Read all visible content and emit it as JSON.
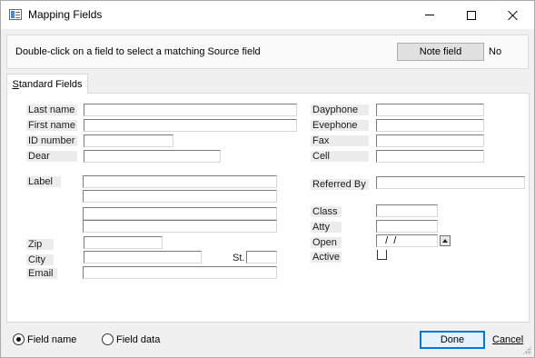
{
  "window": {
    "title": "Mapping Fields",
    "controls": {
      "minimize": "minimize-icon",
      "maximize": "maximize-icon",
      "close": "close-icon"
    }
  },
  "header": {
    "instruction": "Double-click on a field to select a matching Source field",
    "note_button_label": "Note field",
    "note_value": "No"
  },
  "tabs": [
    {
      "label": "Standard Fields",
      "underlined_char": "S",
      "rest": "tandard Fields"
    }
  ],
  "fields_left": {
    "last_name": {
      "label": "Last name",
      "value": ""
    },
    "first_name": {
      "label": "First name",
      "value": ""
    },
    "id_number": {
      "label": "ID number",
      "value": ""
    },
    "dear": {
      "label": "Dear",
      "value": ""
    },
    "label": {
      "label": "Label",
      "lines": [
        "",
        "",
        "",
        ""
      ]
    },
    "zip": {
      "label": "Zip",
      "value": ""
    },
    "city": {
      "label": "City",
      "value": ""
    },
    "state": {
      "label": "St.",
      "value": ""
    },
    "email": {
      "label": "Email",
      "value": ""
    }
  },
  "fields_right": {
    "dayphone": {
      "label": "Dayphone",
      "value": ""
    },
    "evephone": {
      "label": "Evephone",
      "value": ""
    },
    "fax": {
      "label": "Fax",
      "value": ""
    },
    "cell": {
      "label": "Cell",
      "value": ""
    },
    "referred_by": {
      "label": "Referred By",
      "value": ""
    },
    "class": {
      "label": "Class",
      "value": ""
    },
    "atty": {
      "label": "Atty",
      "value": ""
    },
    "open": {
      "label": "Open",
      "value": "  /  /"
    },
    "active": {
      "label": "Active",
      "checked": false
    }
  },
  "footer": {
    "radio_options": [
      {
        "label": "Field name",
        "selected": true
      },
      {
        "label": "Field data",
        "selected": false
      }
    ],
    "done_label": "Done",
    "cancel_label": "Cancel"
  },
  "colors": {
    "accent": "#0078d7",
    "window_bg": "#f0f0f0",
    "label_bg": "#ececec"
  }
}
